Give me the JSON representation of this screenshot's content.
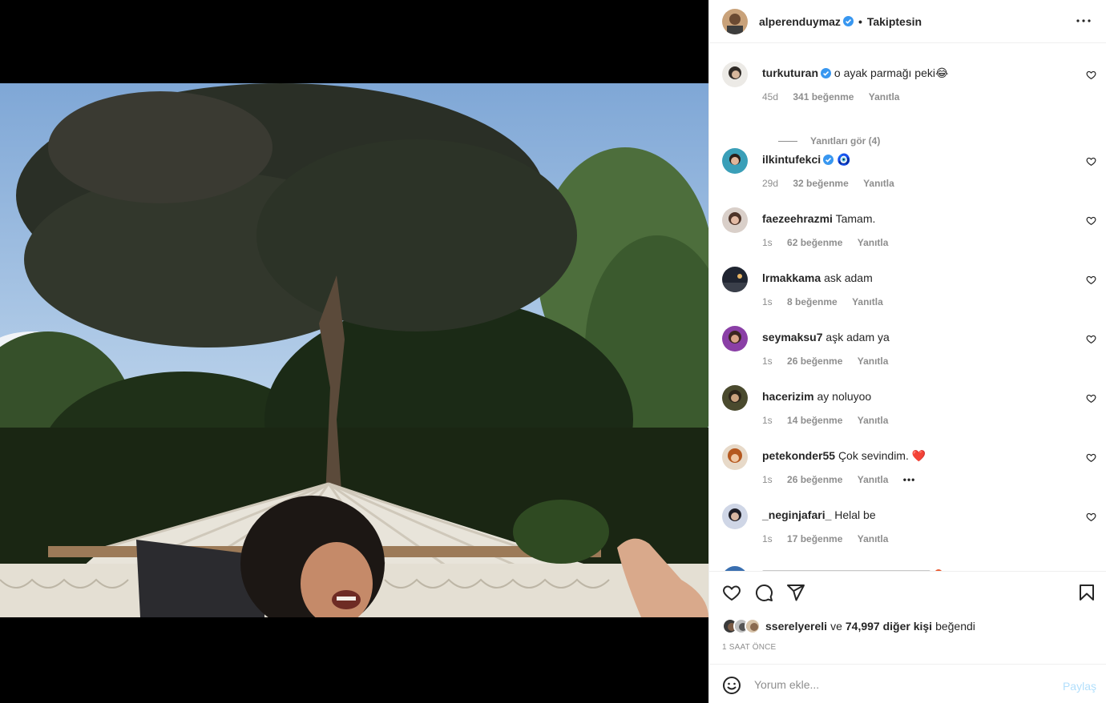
{
  "post": {
    "author": "alperenduymaz",
    "follow_status": "Takiptesin",
    "separator": "•"
  },
  "comments": [
    {
      "user": "turkuturan",
      "verified": true,
      "text": "o ayak parmağı peki😂",
      "age": "45d",
      "likes": "341 beğenme",
      "reply": "Yanıtla",
      "view_replies": "Yanıtları gör (4)"
    },
    {
      "user": "ilkintufekci",
      "verified": true,
      "text": "🧿",
      "age": "29d",
      "likes": "32 beğenme",
      "reply": "Yanıtla"
    },
    {
      "user": "faezeehrazmi",
      "verified": false,
      "text": "Tamam.",
      "age": "1s",
      "likes": "62 beğenme",
      "reply": "Yanıtla"
    },
    {
      "user": "lrmakkama",
      "verified": false,
      "text": "ask adam",
      "age": "1s",
      "likes": "8 beğenme",
      "reply": "Yanıtla"
    },
    {
      "user": "seymaksu7",
      "verified": false,
      "text": "aşk adam ya",
      "age": "1s",
      "likes": "26 beğenme",
      "reply": "Yanıtla"
    },
    {
      "user": "hacerizim",
      "verified": false,
      "text": "ay noluyoo",
      "age": "1s",
      "likes": "14 beğenme",
      "reply": "Yanıtla"
    },
    {
      "user": "petekonder55",
      "verified": false,
      "text": "Çok sevindim. ❤️",
      "age": "1s",
      "likes": "26 beğenme",
      "reply": "Yanıtla",
      "more": "•••"
    },
    {
      "user": "_neginjafari_",
      "verified": false,
      "text": "Helal be",
      "age": "1s",
      "likes": "17 beğenme",
      "reply": "Yanıtla"
    }
  ],
  "likes_line": {
    "first_liker": "sserelyereli",
    "and": "ve",
    "others": "74,997 diğer kişi",
    "suffix": "beğendi"
  },
  "timestamp": "1 SAAT ÖNCE",
  "comment_box": {
    "placeholder": "Yorum ekle...",
    "share_label": "Paylaş"
  },
  "icons": {
    "like": "heart-icon",
    "comment": "comment-icon",
    "share": "paper-plane-icon",
    "save": "bookmark-icon",
    "more": "more-options-icon",
    "emoji": "emoji-icon",
    "verified": "verified-badge-icon"
  },
  "colors": {
    "verified_blue": "#3897f0",
    "share_disabled": "#b2dffc",
    "secondary_text": "#8e8e8e"
  }
}
